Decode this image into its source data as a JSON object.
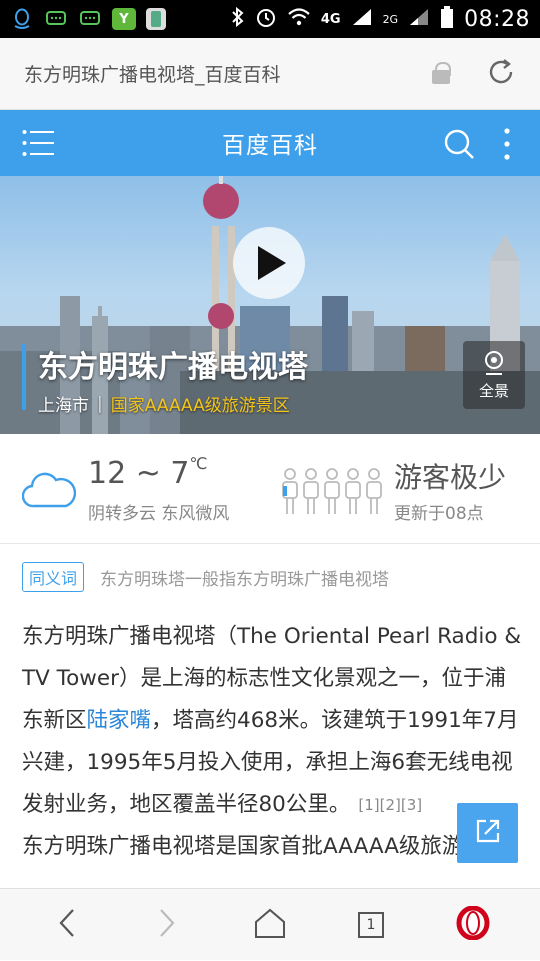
{
  "status_bar": {
    "time": "08:28",
    "net1": "4G",
    "net2": "4G",
    "net3": "2G"
  },
  "address_bar": {
    "title": "东方明珠广播电视塔_百度百科"
  },
  "header": {
    "title": "百度百科"
  },
  "hero": {
    "title": "东方明珠广播电视塔",
    "city": "上海市",
    "separator": "|",
    "scenic_level": "国家AAAAA级旅游景区",
    "panorama_label": "全景"
  },
  "weather": {
    "temperature": "12 ~ 7",
    "unit": "℃",
    "description": "阴转多云 东风微风",
    "crowd_level": "游客极少",
    "crowd_update": "更新于08点"
  },
  "synonym": {
    "tag": "同义词",
    "text": "东方明珠塔一般指东方明珠广播电视塔"
  },
  "article": {
    "p1_a": "东方明珠广播电视塔（The Oriental Pearl Radio & TV Tower）是上海的标志性文化景观之一，位于浦东新区",
    "p1_link": "陆家嘴",
    "p1_b": "，塔高约468米。该建筑于1991年7月兴建，1995年5月投入使用，承担上海6套无线电视发射业务，地区覆盖半径80公里。",
    "p1_refs": "[1][2][3]",
    "p2": "东方明珠广播电视塔是国家首批AAAAA级旅游景区"
  },
  "bottom_nav": {
    "tab_count": "1"
  },
  "colors": {
    "accent": "#3ea0ea",
    "scenic": "#f5c518",
    "opera": "#d0021b"
  }
}
